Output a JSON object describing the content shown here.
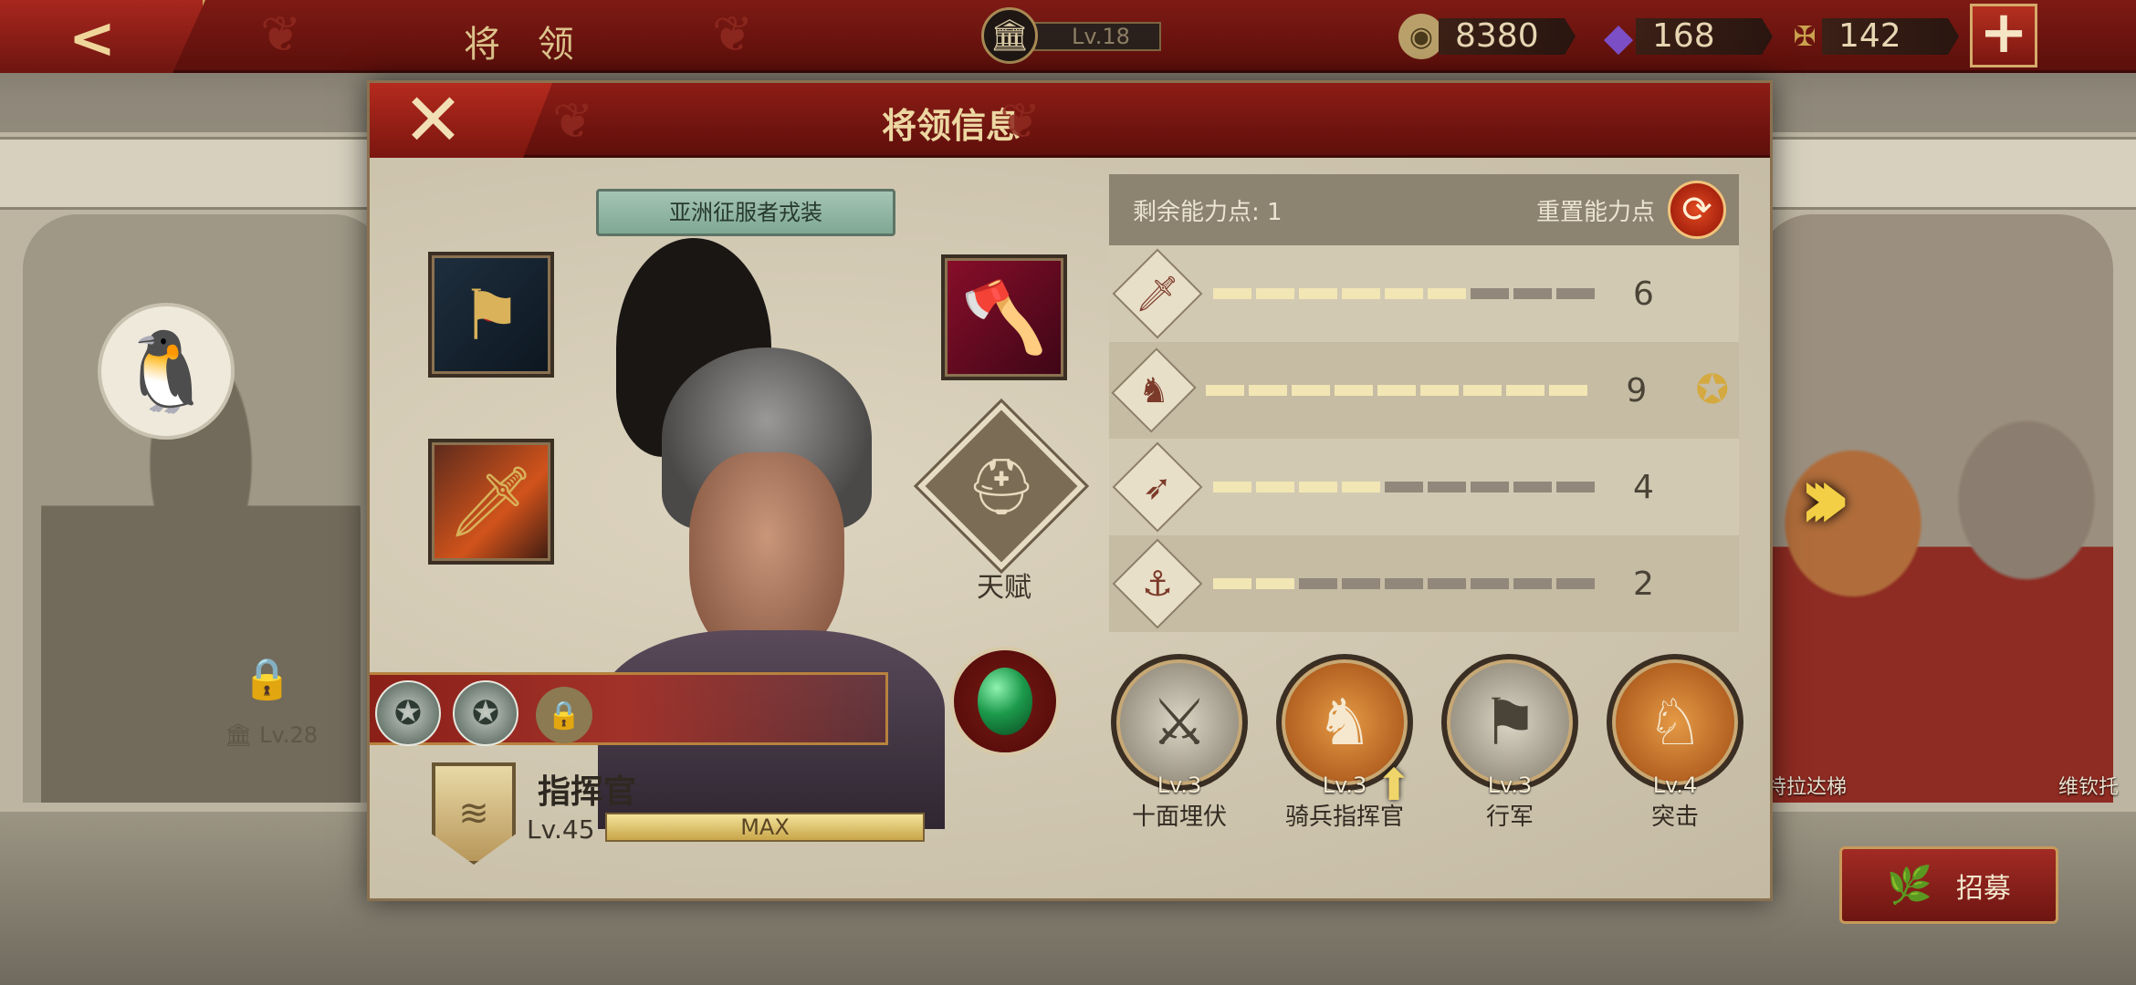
{
  "topbar": {
    "title": "将 领",
    "city_level": "Lv.18",
    "resources": [
      {
        "name": "coin",
        "value": "8380",
        "color": "#b9a06a"
      },
      {
        "name": "gem",
        "value": "168",
        "color": "#7c4fc7"
      },
      {
        "name": "spqr",
        "value": "142",
        "color": "#c9a24e"
      }
    ]
  },
  "background": {
    "left_qq_icon": "qq-penguin-icon",
    "left_level": "Lv.28",
    "right_names": [
      "特拉达梯",
      "维钦托"
    ]
  },
  "recruit": {
    "label": "招募"
  },
  "dialog": {
    "title": "将领信息",
    "outfit": "亚洲征服者戎装",
    "talent_label": "天赋",
    "rank_name": "指挥官",
    "level": "Lv.45",
    "xp_text": "MAX",
    "remaining_points_label": "剩余能力点: 1",
    "reset_label": "重置能力点",
    "stats": [
      {
        "name": "infantry",
        "icon": "sword-icon",
        "value": "6",
        "filled": 6,
        "total": 9,
        "badge": ""
      },
      {
        "name": "cavalry",
        "icon": "horse-icon",
        "value": "9",
        "filled": 9,
        "total": 9,
        "badge": "laurel-star-icon"
      },
      {
        "name": "archery",
        "icon": "bow-icon",
        "value": "4",
        "filled": 4,
        "total": 9,
        "badge": ""
      },
      {
        "name": "navy",
        "icon": "anchor-icon",
        "value": "2",
        "filled": 2,
        "total": 9,
        "badge": ""
      }
    ],
    "skills": [
      {
        "level": "Lv.3",
        "name": "十面埋伏",
        "style": "grey"
      },
      {
        "level": "Lv.3",
        "name": "骑兵指挥官",
        "style": "orange"
      },
      {
        "level": "Lv.3",
        "name": "行军",
        "style": "grey"
      },
      {
        "level": "Lv.4",
        "name": "突击",
        "style": "orange"
      }
    ]
  }
}
